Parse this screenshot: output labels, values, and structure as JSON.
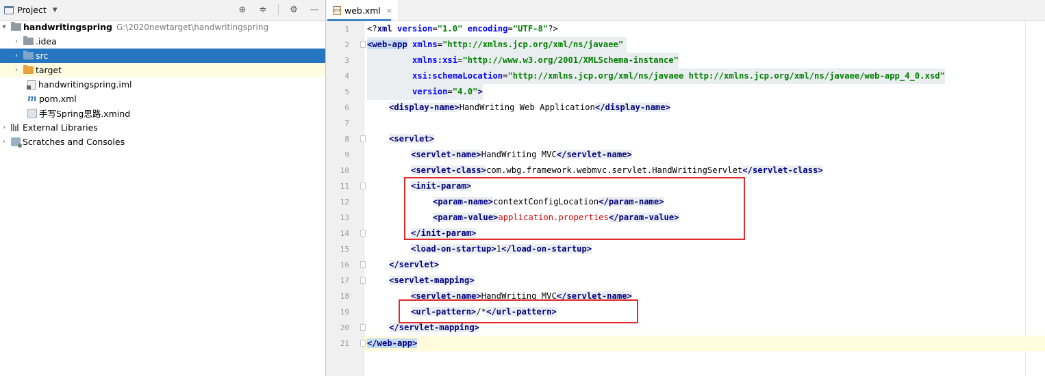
{
  "project": {
    "title": "Project",
    "tree": [
      {
        "label": "handwritingspring",
        "path": "G:\\2020newtarget\\handwritingspring"
      },
      {
        "label": ".idea"
      },
      {
        "label": "src"
      },
      {
        "label": "target"
      },
      {
        "label": "handwritingspring.iml"
      },
      {
        "label": "pom.xml"
      },
      {
        "label": "手写Spring思路.xmind"
      },
      {
        "label": "External Libraries"
      },
      {
        "label": "Scratches and Consoles"
      }
    ]
  },
  "editor": {
    "tab_label": "web.xml",
    "line_numbers": [
      "1",
      "2",
      "3",
      "4",
      "5",
      "6",
      "7",
      "8",
      "9",
      "10",
      "11",
      "12",
      "13",
      "14",
      "15",
      "16",
      "17",
      "18",
      "19",
      "20",
      "21"
    ],
    "code": {
      "l1": {
        "p1": "<?",
        "p2": "xml",
        "p3": " version",
        "p4": "=",
        "p5": "\"1.0\"",
        "p6": " encoding",
        "p7": "=",
        "p8": "\"UTF-8\"",
        "p9": "?>"
      },
      "l2": {
        "tag": "<web-app",
        "attr": " xmlns",
        "eq": "=",
        "val": "\"http://xmlns.jcp.org/xml/ns/javaee\""
      },
      "l3": {
        "attr": "xmlns:xsi",
        "eq": "=",
        "val": "\"http://www.w3.org/2001/XMLSchema-instance\""
      },
      "l4": {
        "attr": "xsi:schemaLocation",
        "eq": "=",
        "val": "\"http://xmlns.jcp.org/xml/ns/javaee http://xmlns.jcp.org/xml/ns/javaee/web-app_4_0.xsd\""
      },
      "l5": {
        "attr": "version",
        "eq": "=",
        "val": "\"4.0\"",
        "end": ">"
      },
      "l6": {
        "open": "<display-name>",
        "text": "HandWriting Web Application",
        "close": "</display-name>"
      },
      "l8": {
        "open": "<servlet>"
      },
      "l9": {
        "open": "<servlet-name>",
        "text": "HandWriting MVC",
        "close": "</servlet-name>"
      },
      "l10": {
        "open": "<servlet-class>",
        "text": "com.wbg.framework.webmvc.servlet.HandWritingServlet",
        "close": "</servlet-class>"
      },
      "l11": {
        "open": "<init-param>"
      },
      "l12": {
        "open": "<param-name>",
        "text": "contextConfigLocation",
        "close": "</param-name>"
      },
      "l13": {
        "open": "<param-value>",
        "text": "application.properties",
        "close": "</param-value>"
      },
      "l14": {
        "close": "</init-param>"
      },
      "l15": {
        "open": "<load-on-startup>",
        "text": "1",
        "close": "</load-on-startup>"
      },
      "l16": {
        "close": "</servlet>"
      },
      "l17": {
        "open": "<servlet-mapping>"
      },
      "l18": {
        "open": "<servlet-name>",
        "text": "HandWriting MVC",
        "close": "</servlet-name>"
      },
      "l19": {
        "open": "<url-pattern>",
        "text": "/*",
        "close": "</url-pattern>"
      },
      "l20": {
        "close": "</servlet-mapping>"
      },
      "l21": {
        "close": "</web-app>"
      }
    }
  },
  "colors": {
    "tag": "#000080",
    "attribute": "#0000ff",
    "value": "#008000",
    "highlight_box": "#e02a2a",
    "selection": "#2675bf"
  }
}
